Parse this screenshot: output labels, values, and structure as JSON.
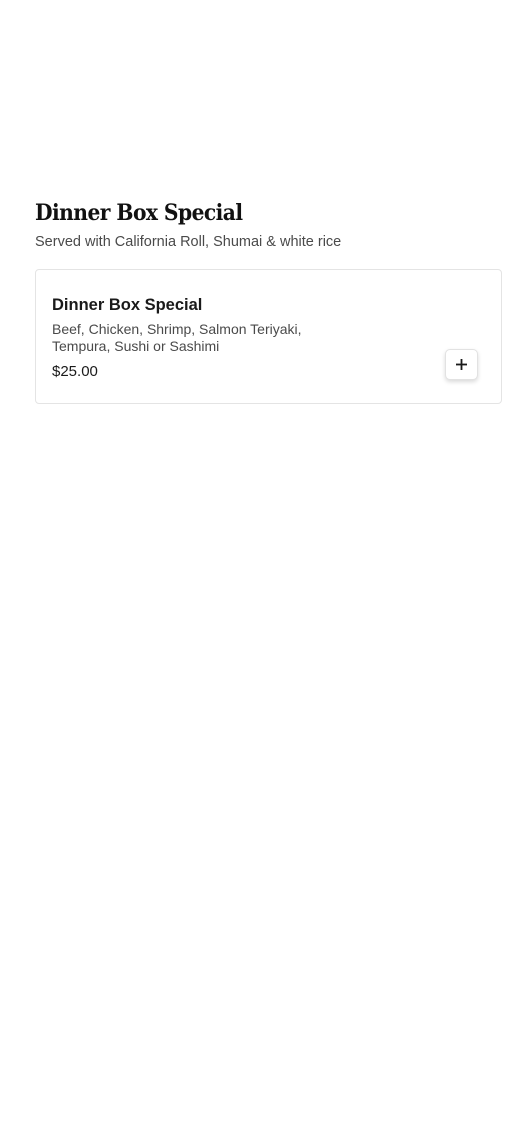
{
  "section": {
    "title": "Dinner Box Special",
    "subtitle": "Served with California Roll, Shumai & white rice"
  },
  "items": [
    {
      "name": "Dinner Box Special",
      "description": "Beef, Chicken, Shrimp, Salmon Teriyaki, Tempura, Sushi or Sashimi",
      "price": "$25.00",
      "add_icon": "plus-icon"
    }
  ]
}
